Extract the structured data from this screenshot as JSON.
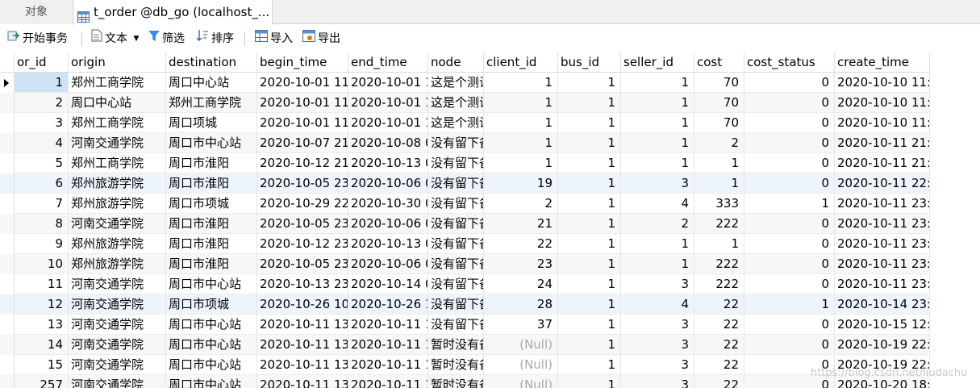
{
  "tabs": {
    "objects_label": "对象",
    "active_label": "t_order @db_go (localhost_..."
  },
  "toolbar": {
    "begin_transaction": "开始事务",
    "text": "文本",
    "filter": "筛选",
    "sort": "排序",
    "import": "导入",
    "export": "导出"
  },
  "columns": [
    "or_id",
    "origin",
    "destination",
    "begin_time",
    "end_time",
    "node",
    "client_id",
    "bus_id",
    "seller_id",
    "cost",
    "cost_status",
    "create_time"
  ],
  "rows": [
    [
      "1",
      "郑州工商学院",
      "周口中心站",
      "2020-10-01 11:",
      "2020-10-01 1",
      "这是个测试",
      "1",
      "1",
      "1",
      "70",
      "0",
      "2020-10-10 11:4"
    ],
    [
      "2",
      "周口中心站",
      "郑州工商学院",
      "2020-10-01 11:",
      "2020-10-01 1",
      "这是个测试",
      "1",
      "1",
      "1",
      "70",
      "0",
      "2020-10-10 11:4"
    ],
    [
      "3",
      "郑州工商学院",
      "周口项城",
      "2020-10-01 11:",
      "2020-10-01 1",
      "这是个测试",
      "1",
      "1",
      "1",
      "70",
      "0",
      "2020-10-10 11:4"
    ],
    [
      "4",
      "河南交通学院",
      "周口市中心站",
      "2020-10-07 21:",
      "2020-10-08 0",
      "没有留下备",
      "1",
      "1",
      "1",
      "2",
      "0",
      "2020-10-11 21:1"
    ],
    [
      "5",
      "郑州工商学院",
      "周口市淮阳",
      "2020-10-12 21:",
      "2020-10-13 0",
      "没有留下备",
      "1",
      "1",
      "1",
      "1",
      "0",
      "2020-10-11 21:2"
    ],
    [
      "6",
      "郑州旅游学院",
      "周口市淮阳",
      "2020-10-05 23:",
      "2020-10-06 0",
      "没有留下备",
      "19",
      "1",
      "3",
      "1",
      "0",
      "2020-10-11 22:5"
    ],
    [
      "7",
      "郑州旅游学院",
      "周口市项城",
      "2020-10-29 22:",
      "2020-10-30 0",
      "没有留下备",
      "2",
      "1",
      "4",
      "333",
      "1",
      "2020-10-11 23:1"
    ],
    [
      "8",
      "河南交通学院",
      "周口市淮阳",
      "2020-10-05 23:",
      "2020-10-06 0",
      "没有留下备",
      "21",
      "1",
      "2",
      "222",
      "0",
      "2020-10-11 23:1"
    ],
    [
      "9",
      "郑州旅游学院",
      "周口市淮阳",
      "2020-10-12 23:",
      "2020-10-13 0",
      "没有留下备",
      "22",
      "1",
      "1",
      "1",
      "0",
      "2020-10-11 23:1"
    ],
    [
      "10",
      "郑州旅游学院",
      "周口市淮阳",
      "2020-10-05 23:",
      "2020-10-06 0",
      "没有留下备",
      "23",
      "1",
      "1",
      "222",
      "0",
      "2020-10-11 23:1"
    ],
    [
      "11",
      "河南交通学院",
      "周口市中心站",
      "2020-10-13 23:",
      "2020-10-14 0",
      "没有留下备",
      "24",
      "1",
      "3",
      "222",
      "0",
      "2020-10-11 23:1"
    ],
    [
      "12",
      "河南交通学院",
      "周口市项城",
      "2020-10-26 10:",
      "2020-10-26 1",
      "没有留下备",
      "28",
      "1",
      "4",
      "22",
      "1",
      "2020-10-14 23:3"
    ],
    [
      "13",
      "河南交通学院",
      "周口市中心站",
      "2020-10-11 13:",
      "2020-10-11 1",
      "没有留下备",
      "37",
      "1",
      "3",
      "22",
      "0",
      "2020-10-15 12:0"
    ],
    [
      "14",
      "河南交通学院",
      "周口市中心站",
      "2020-10-11 13:",
      "2020-10-11 1",
      "暂时没有备",
      "(Null)",
      "1",
      "3",
      "22",
      "0",
      "2020-10-19 22:0"
    ],
    [
      "15",
      "河南交通学院",
      "周口市中心站",
      "2020-10-11 13:",
      "2020-10-11 1",
      "暂时没有备",
      "(Null)",
      "1",
      "3",
      "22",
      "0",
      "2020-10-19 22:0"
    ],
    [
      "257",
      "河南交通学院",
      "周口市中心站",
      "2020-10-11 13:",
      "2020-10-11 1",
      "暂时没有备",
      "(Null)",
      "1",
      "3",
      "22",
      "0",
      "2020-10-20 18:4"
    ]
  ],
  "watermark": "https://blog.csdn.net/liudachu"
}
